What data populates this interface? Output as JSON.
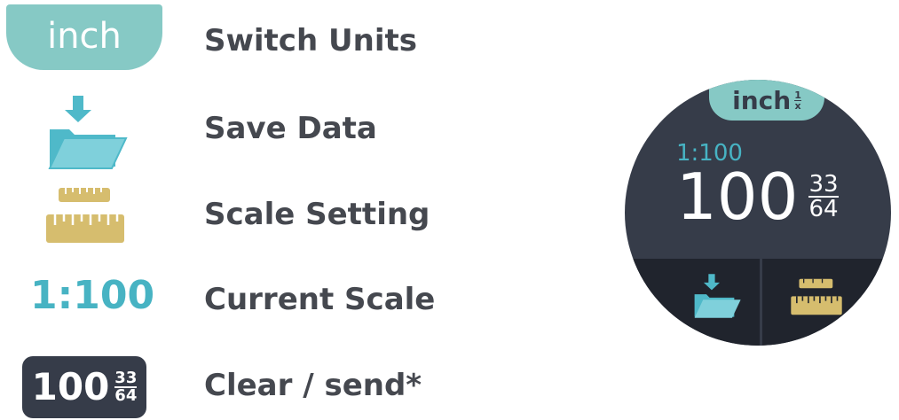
{
  "legend": {
    "items": [
      {
        "label": "Switch Units",
        "icon_name": "inch-units-pill",
        "icon_text": "inch"
      },
      {
        "label": "Save Data",
        "icon_name": "folder-save-icon"
      },
      {
        "label": "Scale Setting",
        "icon_name": "ruler-icon"
      },
      {
        "label": "Current Scale",
        "icon_name": "current-scale-text",
        "icon_text": "1:100"
      },
      {
        "label": "Clear / send*",
        "icon_name": "value-badge",
        "value_int": "100",
        "value_num": "33",
        "value_den": "64"
      }
    ]
  },
  "watch": {
    "unit": "inch",
    "unit_frac_num": "1",
    "unit_frac_den": "x",
    "scale": "1:100",
    "value_int": "100",
    "value_num": "33",
    "value_den": "64",
    "left_button_icon": "folder-save-icon",
    "right_button_icon": "ruler-icon"
  },
  "colors": {
    "teal_pill": "#86c9c5",
    "scale_blue": "#47b3c3",
    "folder_blue": "#4fb9c9",
    "ruler_gold": "#d6bd6e",
    "dark_panel": "#363c49",
    "label_gray": "#45484f"
  }
}
